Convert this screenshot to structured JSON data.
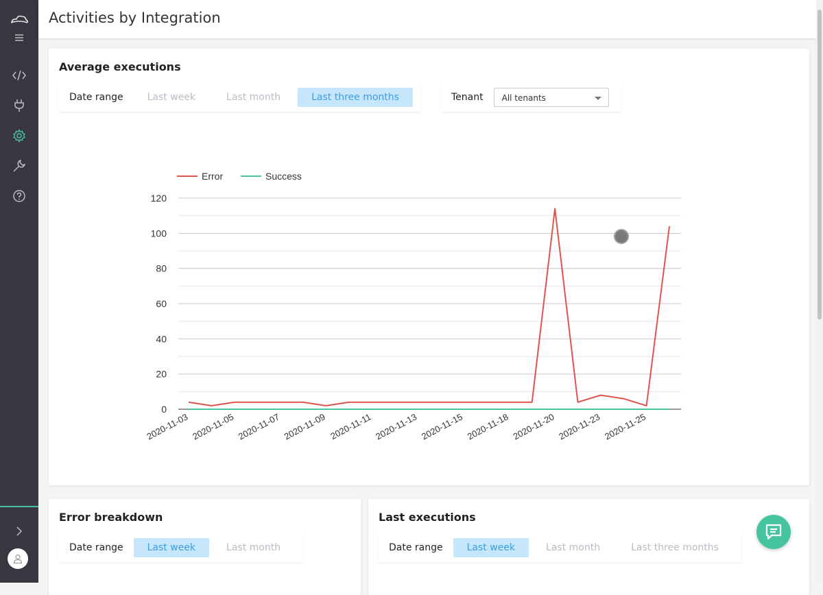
{
  "header": {
    "title": "Activities by Integration"
  },
  "sidebar": {
    "icons": [
      "cloud-logo-icon",
      "menu-icon",
      "code-icon",
      "plug-icon",
      "gear-icon",
      "wrench-icon",
      "help-icon",
      "chevron-right-icon",
      "user-icon"
    ]
  },
  "average_executions": {
    "title": "Average executions",
    "date_range_label": "Date range",
    "options": [
      "Last week",
      "Last month",
      "Last three months"
    ],
    "active_option": "Last three months",
    "tenant_label": "Tenant",
    "tenant_value": "All tenants"
  },
  "error_breakdown": {
    "title": "Error breakdown",
    "date_range_label": "Date range",
    "options": [
      "Last week",
      "Last month"
    ],
    "active_option": "Last week"
  },
  "last_executions": {
    "title": "Last executions",
    "date_range_label": "Date range",
    "options": [
      "Last week",
      "Last month",
      "Last three months"
    ],
    "active_option": "Last week"
  },
  "colors": {
    "error": "#e0524d",
    "success": "#47c4a0",
    "accent": "#3d9ee5",
    "sidebar": "#3a3640"
  },
  "chart_data": {
    "type": "line",
    "x": [
      "2020-11-03",
      "2020-11-04",
      "2020-11-05",
      "2020-11-06",
      "2020-11-07",
      "2020-11-08",
      "2020-11-09",
      "2020-11-10",
      "2020-11-11",
      "2020-11-12",
      "2020-11-13",
      "2020-11-14",
      "2020-11-15",
      "2020-11-16",
      "2020-11-18",
      "2020-11-19",
      "2020-11-20",
      "2020-11-21",
      "2020-11-23",
      "2020-11-24",
      "2020-11-25",
      "2020-11-26"
    ],
    "x_tick_labels": [
      "2020-11-03",
      "2020-11-05",
      "2020-11-07",
      "2020-11-09",
      "2020-11-11",
      "2020-11-13",
      "2020-11-15",
      "2020-11-18",
      "2020-11-20",
      "2020-11-23",
      "2020-11-25"
    ],
    "series": [
      {
        "name": "Error",
        "values": [
          4,
          2,
          4,
          4,
          4,
          4,
          2,
          4,
          4,
          4,
          4,
          4,
          4,
          4,
          4,
          4,
          114,
          4,
          8,
          6,
          2,
          104
        ]
      },
      {
        "name": "Success",
        "values": [
          0,
          0,
          0,
          0,
          0,
          0,
          0,
          0,
          0,
          0,
          0,
          0,
          0,
          0,
          0,
          0,
          0,
          0,
          0,
          0,
          0,
          0
        ]
      }
    ],
    "ylim": [
      0,
      120
    ],
    "y_ticks": [
      0,
      20,
      40,
      60,
      80,
      100,
      120
    ],
    "grid": true,
    "legend": "top-left"
  }
}
